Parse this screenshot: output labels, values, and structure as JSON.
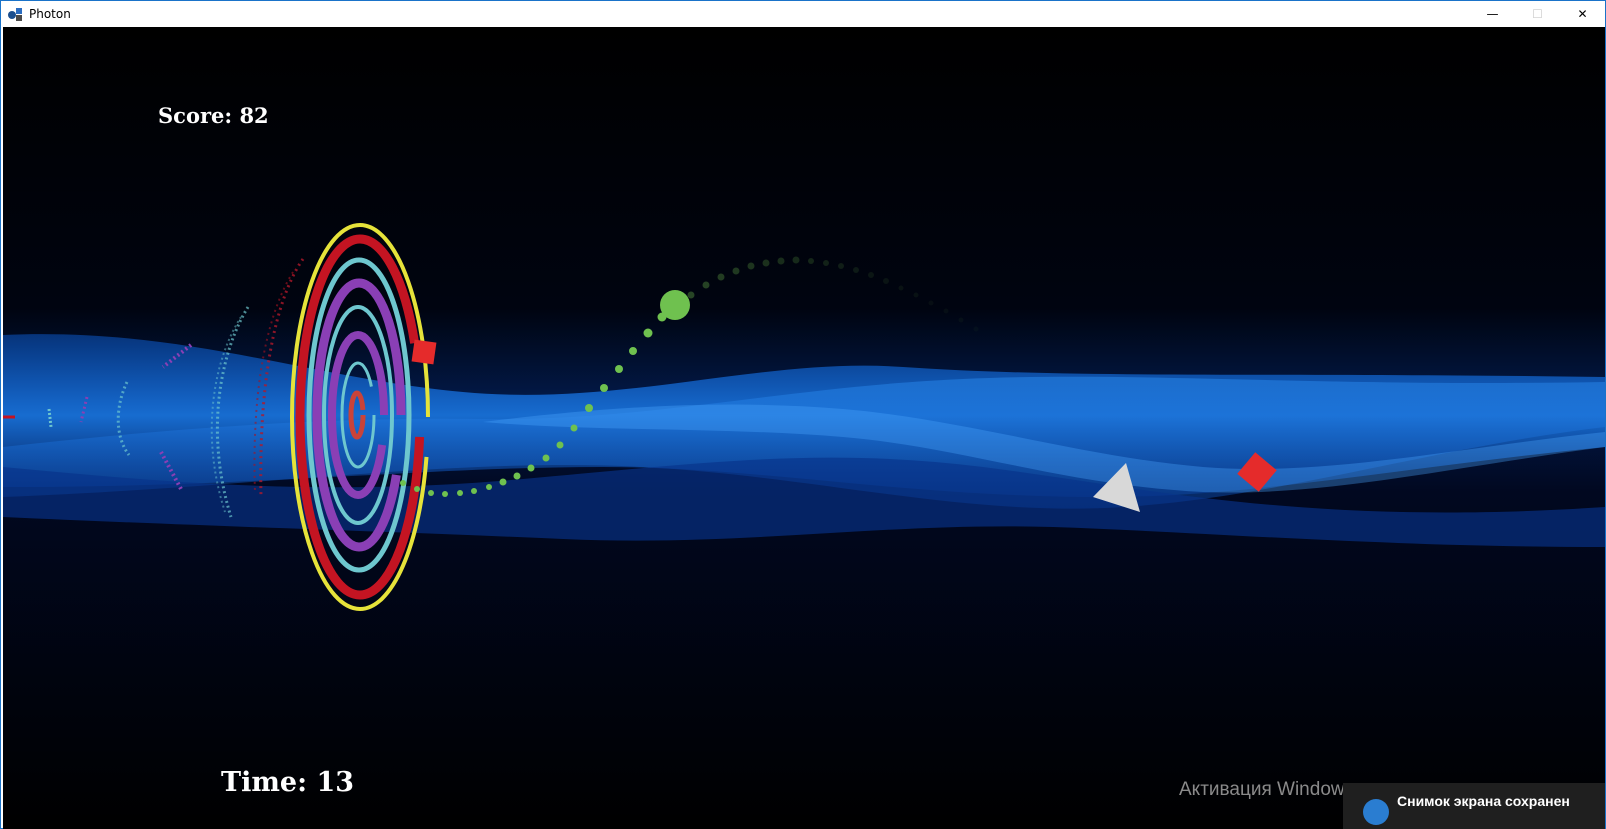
{
  "window": {
    "title": "Photon",
    "controls": {
      "minimize": "—",
      "maximize": "☐",
      "close": "✕"
    }
  },
  "hud": {
    "score_label": "Score: 82",
    "time_label": "Time:  13"
  },
  "overlay": {
    "activation_text": "Активация Windows",
    "toast_text": "Снимок экрана сохранен"
  },
  "colors": {
    "background": "#000000",
    "wave_blue": "#0a63d6",
    "ring_yellow": "#e6e33a",
    "ring_red": "#c41422",
    "ring_teal": "#6ec7cf",
    "ring_purple": "#8a3fb5",
    "ball_green": "#6fc14f",
    "enemy_red": "#e52b2b",
    "ship_white": "#d8d8d8"
  },
  "icons": {
    "app": "photon-logo-icon",
    "player": "triangle-ship-icon",
    "ball": "green-ball-icon",
    "enemy": "red-square-icon"
  }
}
